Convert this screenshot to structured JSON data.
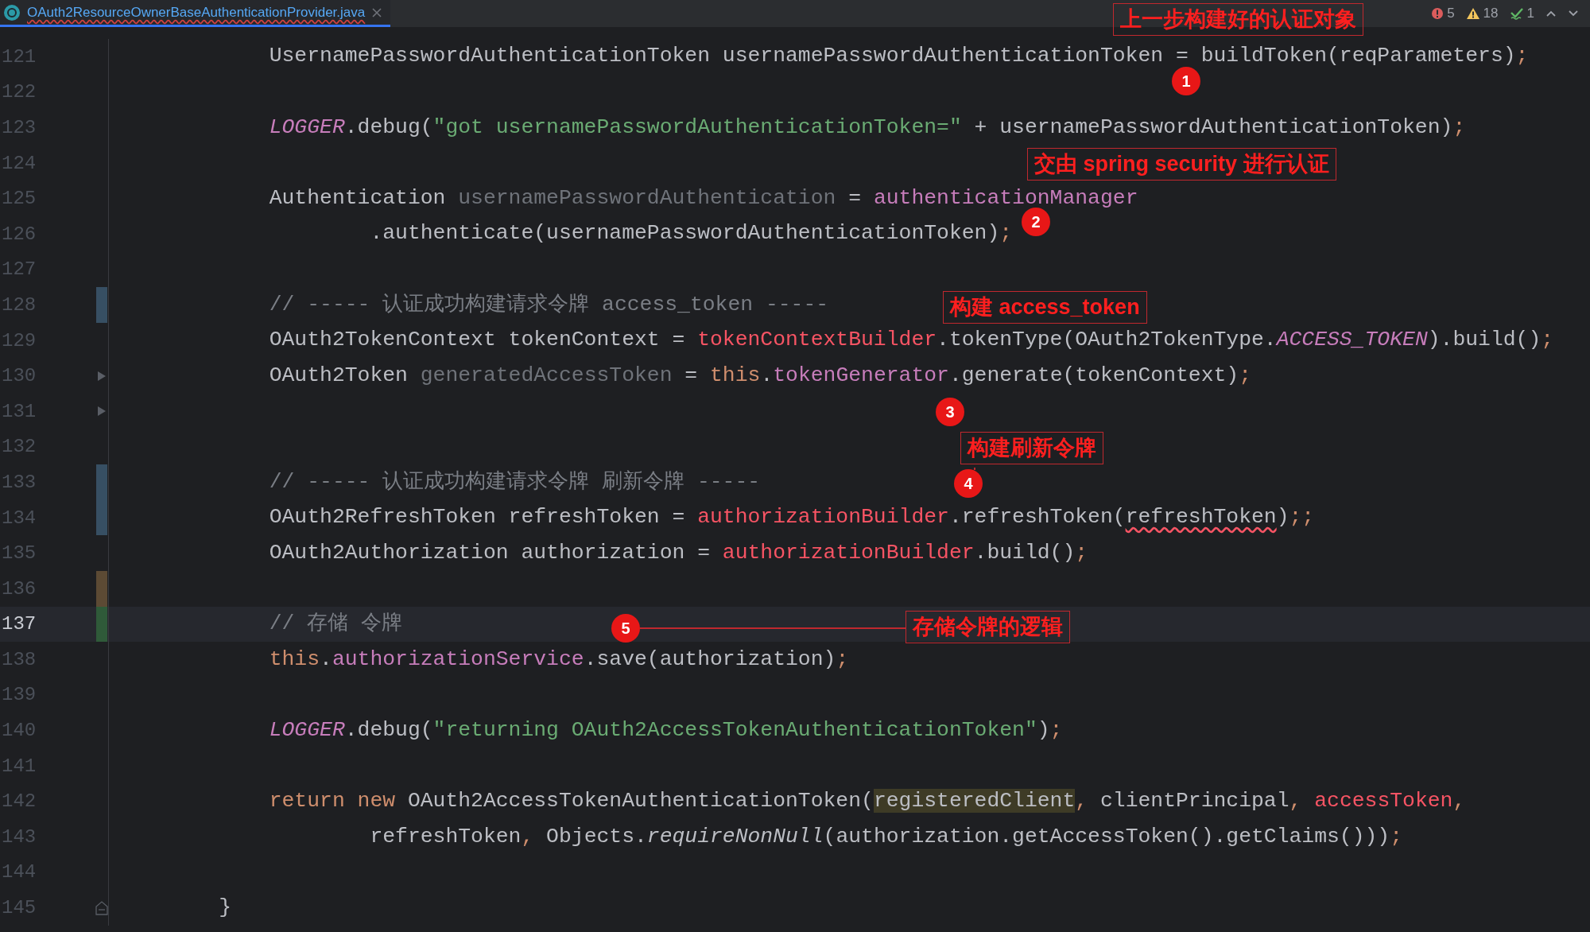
{
  "tab": {
    "title": "OAuth2ResourceOwnerBaseAuthenticationProvider.java",
    "selected": true,
    "has_errors": true
  },
  "inspection": {
    "errors": "5",
    "warnings": "18",
    "checks": "1"
  },
  "lines": [
    {
      "number": "121",
      "current": false,
      "tokens": [
        {
          "text": "        UsernamePasswordAuthenticationToken usernamePasswordAuthenticationToken = buildToken(reqParameters)",
          "kind": "plain"
        },
        {
          "text": ";",
          "kind": "punct"
        }
      ]
    },
    {
      "number": "122",
      "current": false
    },
    {
      "number": "123",
      "current": false,
      "tokens": [
        {
          "text": "        LOGGER",
          "kind": "static"
        },
        {
          "text": ".debug(",
          "kind": "plain"
        },
        {
          "text": "\"got usernamePasswordAuthenticationToken=\"",
          "kind": "string"
        },
        {
          "text": " + usernamePasswordAuthenticationToken)",
          "kind": "plain"
        },
        {
          "text": ";",
          "kind": "punct"
        }
      ]
    },
    {
      "number": "124",
      "current": false
    },
    {
      "number": "125",
      "current": false,
      "tokens": [
        {
          "text": "        Authentication ",
          "kind": "plain"
        },
        {
          "text": "usernamePasswordAuthentication",
          "kind": "unused"
        },
        {
          "text": " = ",
          "kind": "plain"
        },
        {
          "text": "authenticationManager",
          "kind": "field"
        }
      ]
    },
    {
      "number": "126",
      "current": false,
      "tokens": [
        {
          "text": "                .authenticate(usernamePasswordAuthenticationToken)",
          "kind": "plain"
        },
        {
          "text": ";",
          "kind": "punct"
        }
      ]
    },
    {
      "number": "127",
      "current": false
    },
    {
      "number": "128",
      "current": false,
      "color": "#374f63",
      "tokens": [
        {
          "text": "        // ----- 认证成功构建请求令牌 access_token -----",
          "kind": "comment"
        }
      ]
    },
    {
      "number": "129",
      "current": false,
      "tokens": [
        {
          "text": "        OAuth2TokenContext tokenContext = ",
          "kind": "plain"
        },
        {
          "text": "tokenContextBuilder",
          "kind": "error"
        },
        {
          "text": ".tokenType(OAuth2TokenType.",
          "kind": "plain"
        },
        {
          "text": "ACCESS_TOKEN",
          "kind": "static"
        },
        {
          "text": ").build()",
          "kind": "plain"
        },
        {
          "text": ";",
          "kind": "punct"
        }
      ]
    },
    {
      "number": "130",
      "current": false,
      "folded": true,
      "tokens": [
        {
          "text": "        OAuth2Token ",
          "kind": "plain"
        },
        {
          "text": "generatedAccessToken",
          "kind": "unused"
        },
        {
          "text": " = ",
          "kind": "plain"
        },
        {
          "text": "this",
          "kind": "keyword"
        },
        {
          "text": ".",
          "kind": "plain"
        },
        {
          "text": "tokenGenerator",
          "kind": "field"
        },
        {
          "text": ".generate(tokenContext)",
          "kind": "plain"
        },
        {
          "text": ";",
          "kind": "punct"
        }
      ]
    },
    {
      "number": "131",
      "current": false,
      "folded": true
    },
    {
      "number": "132",
      "current": false
    },
    {
      "number": "133",
      "current": false,
      "color": "#374f63",
      "tokens": [
        {
          "text": "        // ----- 认证成功构建请求令牌 刷新令牌 -----",
          "kind": "comment"
        }
      ]
    },
    {
      "number": "134",
      "current": false,
      "color": "#374f63",
      "tokens": [
        {
          "text": "        OAuth2RefreshToken refreshToken = ",
          "kind": "plain"
        },
        {
          "text": "authorizationBuilder",
          "kind": "error"
        },
        {
          "text": ".refreshToken(",
          "kind": "plain"
        },
        {
          "text": "refreshToken",
          "kind": "squiggle"
        },
        {
          "text": ")",
          "kind": "plain"
        },
        {
          "text": ";;",
          "kind": "punct"
        }
      ]
    },
    {
      "number": "135",
      "current": false,
      "tokens": [
        {
          "text": "        OAuth2Authorization authorization = ",
          "kind": "plain"
        },
        {
          "text": "authorizationBuilder",
          "kind": "error"
        },
        {
          "text": ".build()",
          "kind": "plain"
        },
        {
          "text": ";",
          "kind": "punct"
        }
      ]
    },
    {
      "number": "136",
      "current": false,
      "color": "#5c4a34"
    },
    {
      "number": "137",
      "current": true,
      "color": "#2f5a39",
      "tokens": [
        {
          "text": "        // 存储 令牌",
          "kind": "comment"
        }
      ]
    },
    {
      "number": "138",
      "current": false,
      "tokens": [
        {
          "text": "        this",
          "kind": "keyword"
        },
        {
          "text": ".",
          "kind": "plain"
        },
        {
          "text": "authorizationService",
          "kind": "field"
        },
        {
          "text": ".save(authorization)",
          "kind": "plain"
        },
        {
          "text": ";",
          "kind": "punct"
        }
      ]
    },
    {
      "number": "139",
      "current": false
    },
    {
      "number": "140",
      "current": false,
      "tokens": [
        {
          "text": "        LOGGER",
          "kind": "static"
        },
        {
          "text": ".debug(",
          "kind": "plain"
        },
        {
          "text": "\"returning OAuth2AccessTokenAuthenticationToken\"",
          "kind": "string"
        },
        {
          "text": ")",
          "kind": "plain"
        },
        {
          "text": ";",
          "kind": "punct"
        }
      ]
    },
    {
      "number": "141",
      "current": false
    },
    {
      "number": "142",
      "current": false,
      "tokens": [
        {
          "text": "        return",
          "kind": "keyword"
        },
        {
          "text": " new",
          "kind": "keyword"
        },
        {
          "text": " OAuth2AccessTokenAuthenticationToken(",
          "kind": "plain"
        },
        {
          "text": "registeredClient",
          "kind": "highlight"
        },
        {
          "text": ",",
          "kind": "punct"
        },
        {
          "text": " clientPrincipal",
          "kind": "plain"
        },
        {
          "text": ",",
          "kind": "punct"
        },
        {
          "text": " accessToken",
          "kind": "error"
        },
        {
          "text": ",",
          "kind": "punct"
        }
      ]
    },
    {
      "number": "143",
      "current": false,
      "tokens": [
        {
          "text": "                refreshToken",
          "kind": "plain"
        },
        {
          "text": ",",
          "kind": "punct"
        },
        {
          "text": " Objects.",
          "kind": "plain"
        },
        {
          "text": "requireNonNull",
          "kind": "italic"
        },
        {
          "text": "(authorization.getAccessToken().getClaims()))",
          "kind": "plain"
        },
        {
          "text": ";",
          "kind": "punct"
        }
      ]
    },
    {
      "number": "144",
      "current": false
    },
    {
      "number": "145",
      "current": false,
      "fold_end": true,
      "tokens": [
        {
          "text": "    }",
          "kind": "plain"
        }
      ]
    }
  ],
  "annotations": [
    {
      "number": "1",
      "text": "上一步构建好的认证对象"
    },
    {
      "number": "2",
      "text": "交由 spring security 进行认证"
    },
    {
      "number": "3",
      "text": "构建 access_token"
    },
    {
      "number": "4",
      "text": "构建刷新令牌"
    },
    {
      "number": "5",
      "text": "存储令牌的逻辑"
    }
  ]
}
